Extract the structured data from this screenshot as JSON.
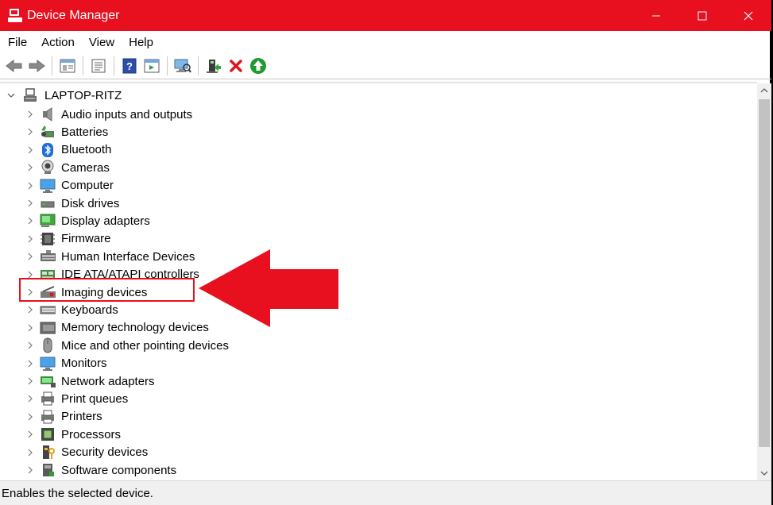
{
  "window": {
    "title": "Device Manager"
  },
  "menu": [
    "File",
    "Action",
    "View",
    "Help"
  ],
  "toolbar": {
    "buttons": [
      "back-arrow-icon",
      "forward-arrow-icon",
      "properties-icon",
      "device-list-icon",
      "help-icon",
      "view-icon",
      "scan-hardware-icon",
      "enable-device-icon",
      "uninstall-icon",
      "update-driver-icon"
    ]
  },
  "tree": {
    "root": "LAPTOP-RITZ",
    "items": [
      {
        "label": "Audio inputs and outputs",
        "icon": "speaker-icon"
      },
      {
        "label": "Batteries",
        "icon": "battery-icon"
      },
      {
        "label": "Bluetooth",
        "icon": "bluetooth-icon"
      },
      {
        "label": "Cameras",
        "icon": "camera-icon"
      },
      {
        "label": "Computer",
        "icon": "computer-icon"
      },
      {
        "label": "Disk drives",
        "icon": "disk-drive-icon"
      },
      {
        "label": "Display adapters",
        "icon": "display-adapter-icon"
      },
      {
        "label": "Firmware",
        "icon": "firmware-icon"
      },
      {
        "label": "Human Interface Devices",
        "icon": "hid-icon"
      },
      {
        "label": "IDE ATA/ATAPI controllers",
        "icon": "ide-controller-icon"
      },
      {
        "label": "Imaging devices",
        "icon": "imaging-device-icon"
      },
      {
        "label": "Keyboards",
        "icon": "keyboard-icon"
      },
      {
        "label": "Memory technology devices",
        "icon": "memory-icon"
      },
      {
        "label": "Mice and other pointing devices",
        "icon": "mouse-icon"
      },
      {
        "label": "Monitors",
        "icon": "monitor-icon"
      },
      {
        "label": "Network adapters",
        "icon": "network-adapter-icon"
      },
      {
        "label": "Print queues",
        "icon": "print-queue-icon"
      },
      {
        "label": "Printers",
        "icon": "printer-icon"
      },
      {
        "label": "Processors",
        "icon": "processor-icon"
      },
      {
        "label": "Security devices",
        "icon": "security-device-icon"
      },
      {
        "label": "Software components",
        "icon": "software-component-icon"
      }
    ]
  },
  "status": {
    "text": "Enables the selected device."
  },
  "colors": {
    "accent": "#e8101e",
    "annotation": "#e8101e"
  }
}
